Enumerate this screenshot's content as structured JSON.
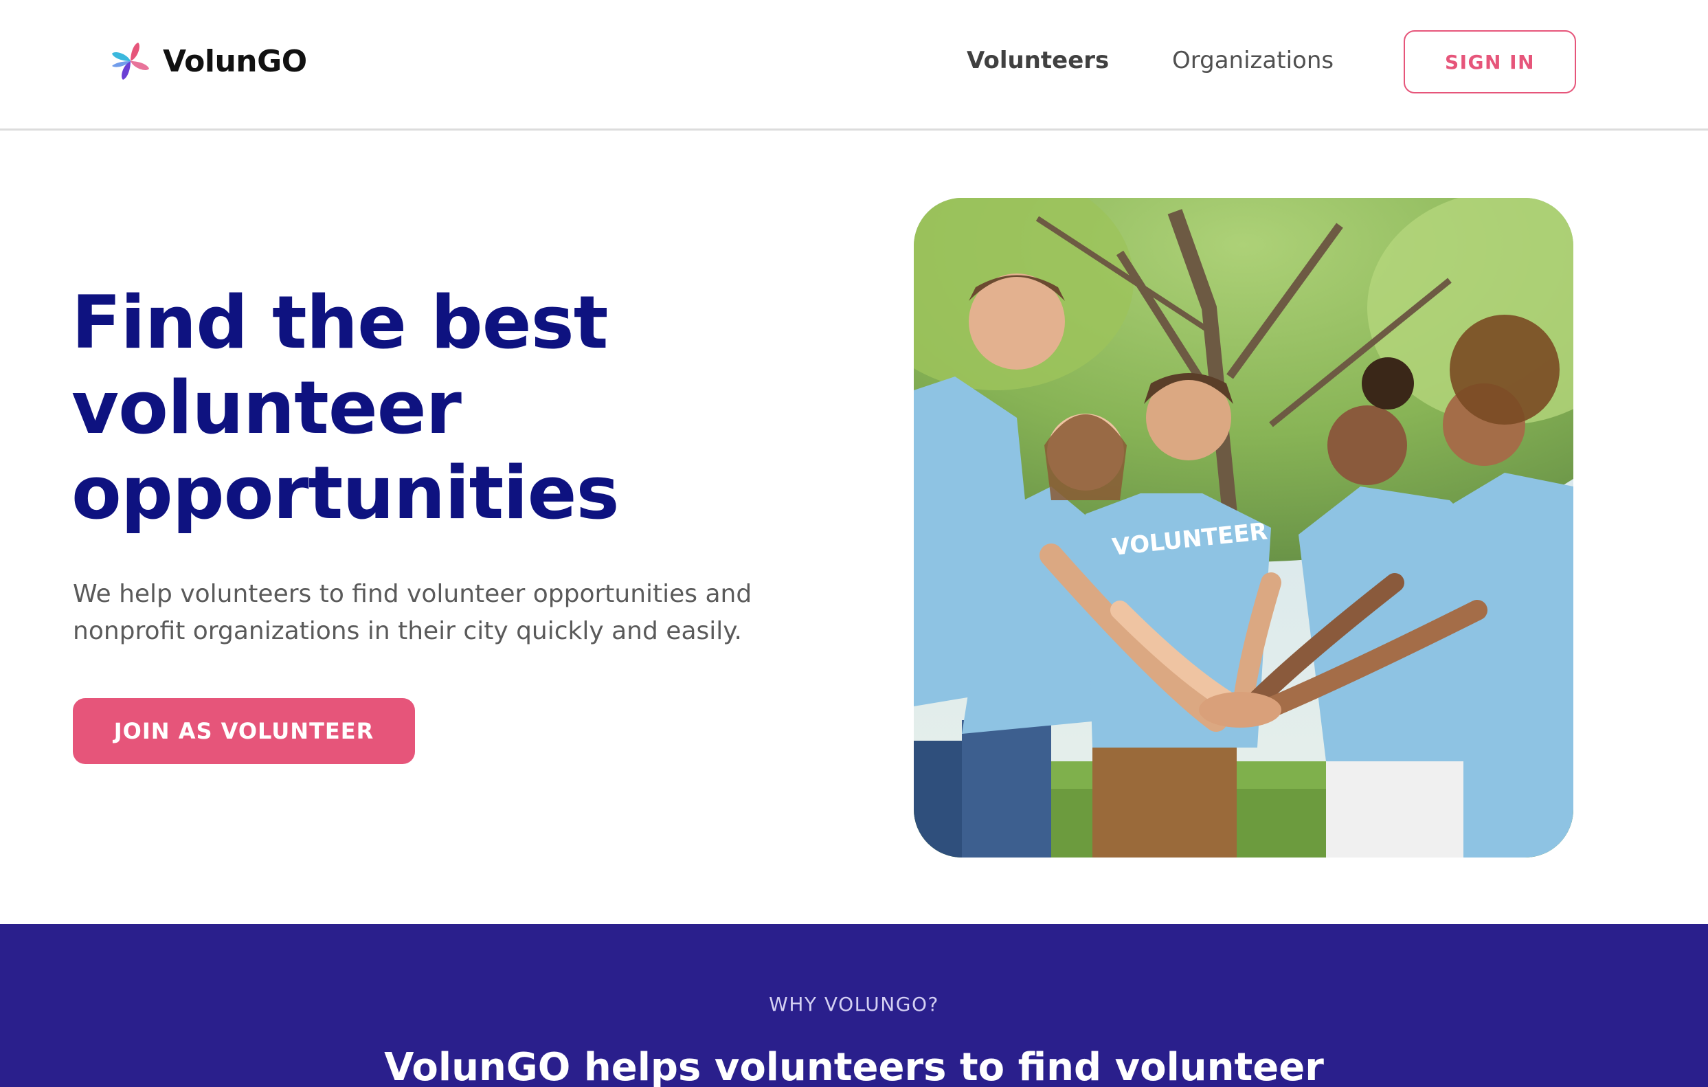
{
  "header": {
    "brand": "VolunGO",
    "nav": {
      "volunteers": "Volunteers",
      "organizations": "Organizations"
    },
    "signin_label": "SIGN IN"
  },
  "hero": {
    "title_lines": [
      "Find the best",
      "volunteer",
      "opportunities"
    ],
    "description_lines": [
      "We help volunteers to find volunteer opportunities and",
      "nonprofit organizations in their city quickly and easily."
    ],
    "cta_label": "JOIN AS VOLUNTEER",
    "image_shirt_text": "VOLUNTEER"
  },
  "why": {
    "kicker": "WHY VOLUNGO?",
    "heading": "VolunGO helps volunteers to find volunteer"
  },
  "colors": {
    "accent": "#e6557a",
    "title": "#0e1280",
    "section_bg": "#2a1f8c",
    "shirt": "#8ec3e3"
  },
  "icons": {
    "logo": "pinwheel-logo-icon"
  }
}
